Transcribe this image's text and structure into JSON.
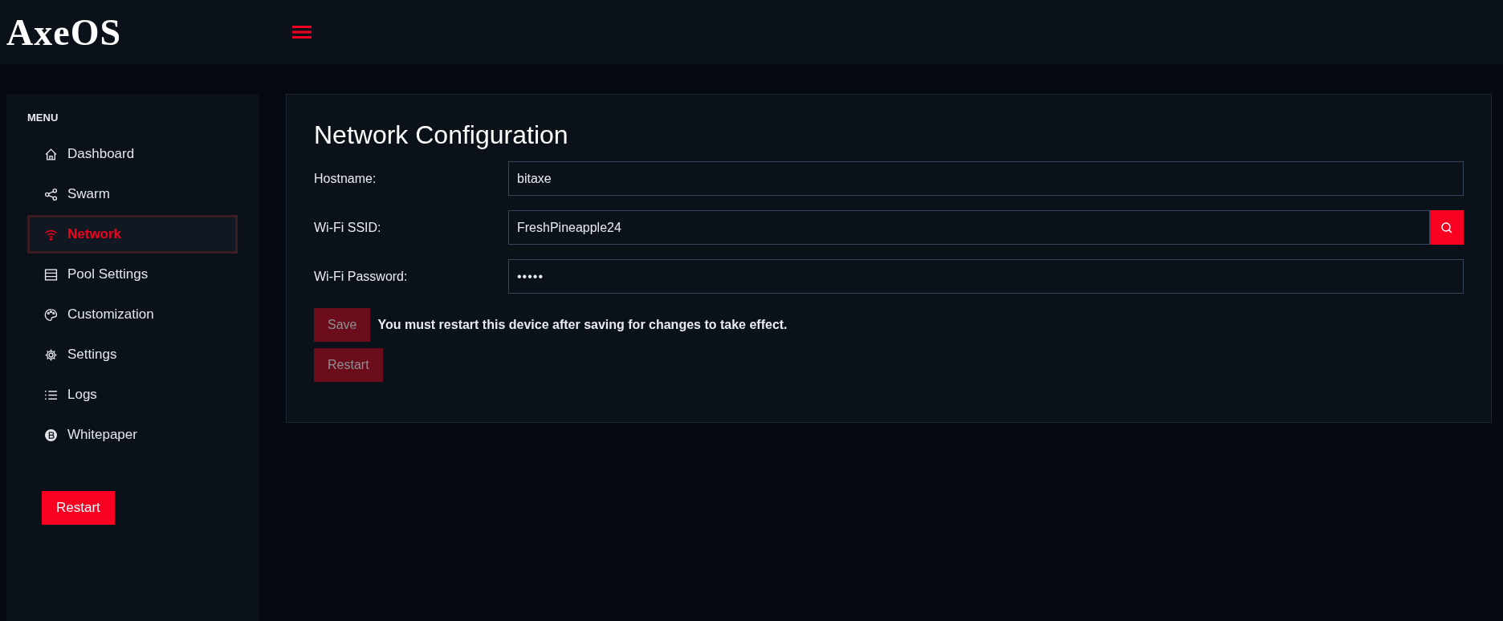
{
  "header": {
    "logo": "AxeOS"
  },
  "sidebar": {
    "heading": "MENU",
    "items": [
      {
        "label": "Dashboard",
        "selected": false
      },
      {
        "label": "Swarm",
        "selected": false
      },
      {
        "label": "Network",
        "selected": true
      },
      {
        "label": "Pool Settings",
        "selected": false
      },
      {
        "label": "Customization",
        "selected": false
      },
      {
        "label": "Settings",
        "selected": false
      },
      {
        "label": "Logs",
        "selected": false
      },
      {
        "label": "Whitepaper",
        "selected": false
      }
    ],
    "restart_button": "Restart"
  },
  "card": {
    "title": "Network Configuration",
    "fields": [
      {
        "label": "Hostname:",
        "value": "bitaxe",
        "kind": "text"
      },
      {
        "label": "Wi-Fi SSID:",
        "value": "FreshPineapple24",
        "kind": "search"
      },
      {
        "label": "Wi-Fi Password:",
        "value": "•••••",
        "kind": "password"
      }
    ],
    "save_button": {
      "label": "Save",
      "disabled": true
    },
    "notice": "You must restart this device after saving for changes to take effect.",
    "restart_button": {
      "label": "Restart",
      "disabled": true
    }
  }
}
